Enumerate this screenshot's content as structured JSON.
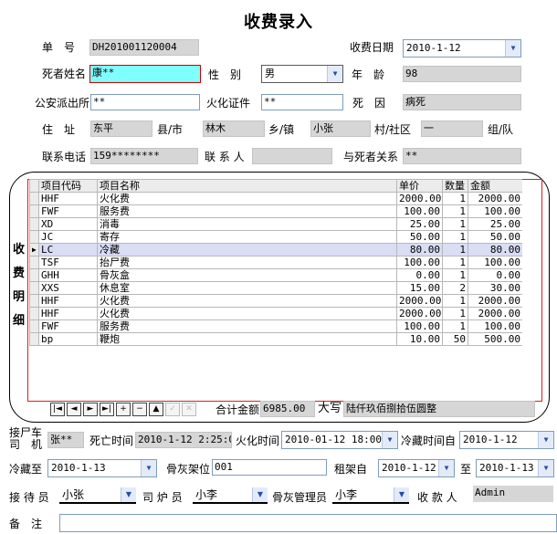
{
  "title": "收费录入",
  "form": {
    "id_label": "单　号",
    "id_value": "DH201001120004",
    "charge_date_label": "收费日期",
    "charge_date_value": "2010-1-12",
    "name_label": "死者姓名",
    "name_value": "康**",
    "gender_label": "性　别",
    "gender_value": "男",
    "age_label": "年　龄",
    "age_value": "98",
    "police_label": "公安派出所",
    "police_value": "**",
    "cremation_cert_label": "火化证件",
    "cremation_cert_value": "**",
    "death_cause_label": "死　因",
    "death_cause_value": "病死",
    "address_label": "住　址",
    "county_value": "东平",
    "county_label": "县/市",
    "town_value": "林木",
    "town_label": "乡/镇",
    "village_value": "小张",
    "village_label": "村/社区",
    "group_value": "一",
    "group_label": "组/队",
    "phone_label": "联系电话",
    "phone_value": "159********",
    "contact_label": "联 系 人",
    "contact_value": "",
    "relation_label": "与死者关系",
    "relation_value": "**"
  },
  "detail_side_label": [
    "收",
    "费",
    "明",
    "细"
  ],
  "grid": {
    "columns": [
      "项目代码",
      "项目名称",
      "单价",
      "数量",
      "金额"
    ],
    "rows": [
      {
        "code": "HHF",
        "name": "火化费",
        "price": "2000.00",
        "qty": "1",
        "amount": "2000.00"
      },
      {
        "code": "FWF",
        "name": "服务费",
        "price": "100.00",
        "qty": "1",
        "amount": "100.00"
      },
      {
        "code": "XD",
        "name": "消毒",
        "price": "25.00",
        "qty": "1",
        "amount": "25.00"
      },
      {
        "code": "JC",
        "name": "寄存",
        "price": "50.00",
        "qty": "1",
        "amount": "50.00"
      },
      {
        "code": "LC",
        "name": "冷藏",
        "price": "80.00",
        "qty": "1",
        "amount": "80.00",
        "selected": true
      },
      {
        "code": "TSF",
        "name": "抬尸费",
        "price": "100.00",
        "qty": "1",
        "amount": "100.00"
      },
      {
        "code": "GHH",
        "name": "骨灰盒",
        "price": "0.00",
        "qty": "1",
        "amount": "0.00"
      },
      {
        "code": "XXS",
        "name": "休息室",
        "price": "15.00",
        "qty": "2",
        "amount": "30.00"
      },
      {
        "code": "HHF",
        "name": "火化费",
        "price": "2000.00",
        "qty": "1",
        "amount": "2000.00"
      },
      {
        "code": "HHF",
        "name": "火化费",
        "price": "2000.00",
        "qty": "1",
        "amount": "2000.00"
      },
      {
        "code": "FWF",
        "name": "服务费",
        "price": "100.00",
        "qty": "1",
        "amount": "100.00"
      },
      {
        "code": "bp",
        "name": "鞭炮",
        "price": "10.00",
        "qty": "50",
        "amount": "500.00"
      }
    ]
  },
  "navigator": [
    "|◄",
    "◄",
    "►",
    "►|",
    "+",
    "−",
    "▲",
    "✓",
    "✕"
  ],
  "total_label": "合计金额",
  "total_value": "6985.00",
  "total_upper_label": "大写",
  "total_upper_value": "陆仟玖佰捌拾伍圆整",
  "bottom": {
    "driver_label": "接尸车司　机",
    "driver_value": "张**",
    "death_time_label": "死亡时间",
    "death_time_value": "2010-1-12 2:25:00",
    "cremation_time_label": "火化时间",
    "cremation_time_value": "2010-01-12 18:00",
    "cold_from_label": "冷藏时间自",
    "cold_from_value": "2010-1-12",
    "cold_to_label": "冷藏至",
    "cold_to_value": "2010-1-13",
    "shelf_label": "骨灰架位",
    "shelf_value": "001",
    "rent_from_label": "租架自",
    "rent_from_value": "2010-1-12",
    "rent_to_label": "至",
    "rent_to_value": "2010-1-13",
    "receptionist_label": "接 待 员",
    "receptionist_value": "小张",
    "stoker_label": "司 炉 员",
    "stoker_value": "小李",
    "ash_manager_label": "骨灰管理员",
    "ash_manager_value": "小李",
    "cashier_label": "收 款 人",
    "cashier_value": "Admin",
    "remark_label": "备　注",
    "remark_value": ""
  }
}
